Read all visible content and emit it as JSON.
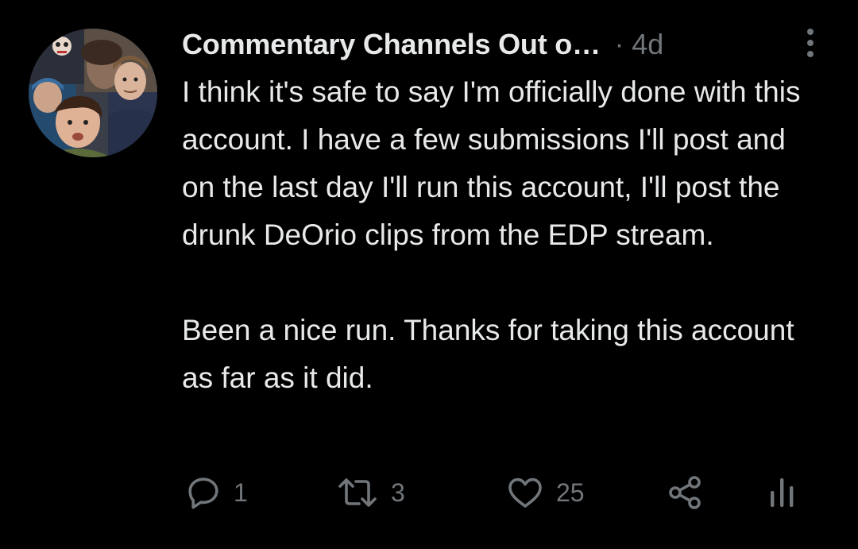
{
  "tweet": {
    "display_name": "Commentary Channels Out o…",
    "separator": "·",
    "timestamp": "4d",
    "paragraphs": [
      "I think it's safe to say I'm officially done with this account. I have a few submissions I'll post and on the last day I'll run this account, I'll post the drunk DeOrio clips from the EDP stream.",
      "Been a nice run. Thanks for taking this account as far as it did."
    ],
    "actions": {
      "reply_count": "1",
      "retweet_count": "3",
      "like_count": "25"
    }
  },
  "icons": {
    "more": "more-vertical-icon",
    "reply": "reply-icon",
    "retweet": "retweet-icon",
    "like": "heart-icon",
    "share": "share-icon",
    "analytics": "analytics-icon"
  },
  "colors": {
    "background": "#000000",
    "text_primary": "#e7e9ea",
    "text_secondary": "#71767b"
  }
}
